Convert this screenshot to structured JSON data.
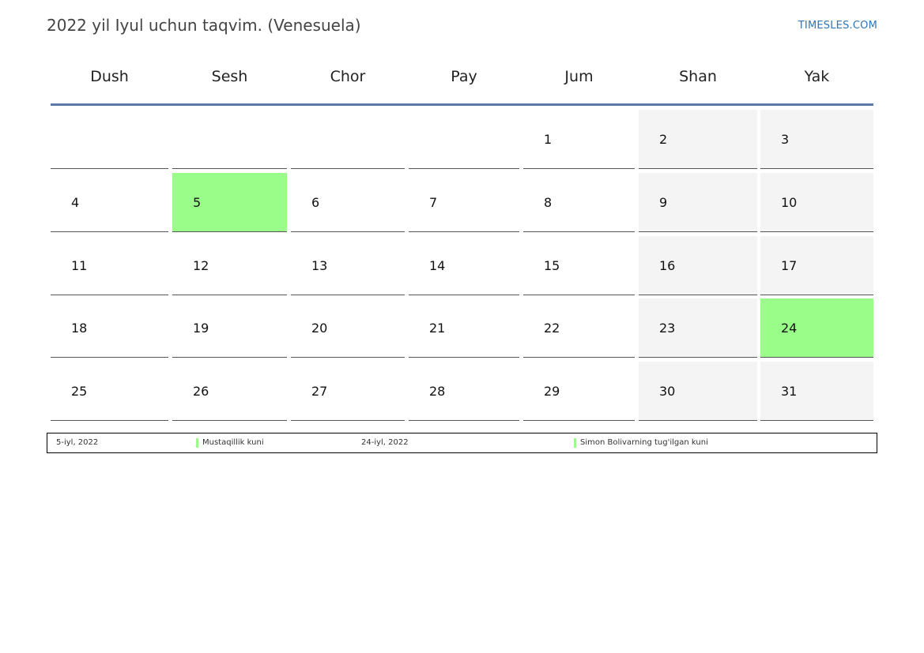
{
  "header": {
    "title": "2022 yil Iyul uchun taqvim. (Venesuela)",
    "site": "TIMESLES.COM"
  },
  "weekdays": [
    "Dush",
    "Sesh",
    "Chor",
    "Pay",
    "Jum",
    "Shan",
    "Yak"
  ],
  "weeks": [
    [
      "",
      "",
      "",
      "",
      "1",
      "2",
      "3"
    ],
    [
      "4",
      "5",
      "6",
      "7",
      "8",
      "9",
      "10"
    ],
    [
      "11",
      "12",
      "13",
      "14",
      "15",
      "16",
      "17"
    ],
    [
      "18",
      "19",
      "20",
      "21",
      "22",
      "23",
      "24"
    ],
    [
      "25",
      "26",
      "27",
      "28",
      "29",
      "30",
      "31"
    ]
  ],
  "holiday_days": [
    "5",
    "24"
  ],
  "colors": {
    "holiday": "#9afd8a",
    "weekend": "#f4f4f4",
    "accent": "#5b7ba6",
    "site_link": "#2e75b5"
  },
  "legend": [
    {
      "date": "5-iyl, 2022",
      "name": "Mustaqillik kuni"
    },
    {
      "date": "24-iyl, 2022",
      "name": "Simon Bolivarning tug'ilgan kuni"
    }
  ]
}
